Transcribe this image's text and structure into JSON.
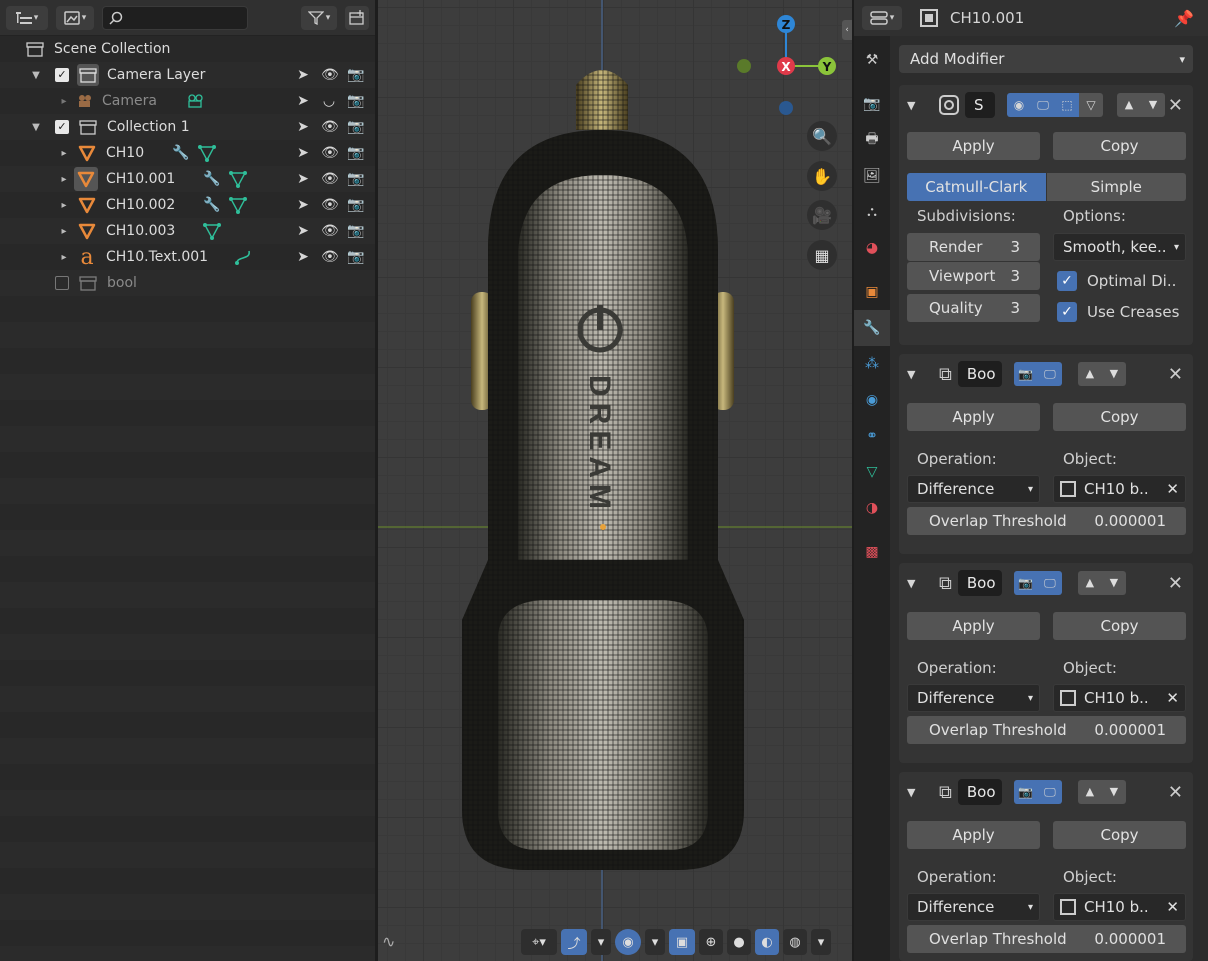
{
  "outliner": {
    "items": [
      {
        "label": "Scene Collection"
      },
      {
        "label": "Camera Layer"
      },
      {
        "label": "Camera"
      },
      {
        "label": "Collection 1"
      },
      {
        "label": "CH10"
      },
      {
        "label": "CH10.001"
      },
      {
        "label": "CH10.002"
      },
      {
        "label": "CH10.003"
      },
      {
        "label": "CH10.Text.001"
      },
      {
        "label": "bool"
      }
    ]
  },
  "viewport": {
    "axes": {
      "z": "Z",
      "x": "X",
      "y": "Y"
    },
    "model_text": "DREAM"
  },
  "properties": {
    "object_name": "CH10.001",
    "add_modifier": "Add Modifier",
    "subsurf": {
      "name": "S",
      "apply": "Apply",
      "copy": "Copy",
      "type_a": "Catmull-Clark",
      "type_b": "Simple",
      "subdivisions_label": "Subdivisions:",
      "options_label": "Options:",
      "render_label": "Render",
      "render_value": "3",
      "viewport_label": "Viewport",
      "viewport_value": "3",
      "quality_label": "Quality",
      "quality_value": "3",
      "uv_smooth": "Smooth, kee..",
      "optimal_display": "Optimal Di..",
      "use_creases": "Use Creases"
    },
    "booleans": [
      {
        "name": "Boo",
        "apply": "Apply",
        "copy": "Copy",
        "operation_label": "Operation:",
        "object_label": "Object:",
        "operation": "Difference",
        "object": "CH10 b..",
        "overlap_label": "Overlap Threshold",
        "overlap_value": "0.000001"
      },
      {
        "name": "Boo",
        "apply": "Apply",
        "copy": "Copy",
        "operation_label": "Operation:",
        "object_label": "Object:",
        "operation": "Difference",
        "object": "CH10 b..",
        "overlap_label": "Overlap Threshold",
        "overlap_value": "0.000001"
      },
      {
        "name": "Boo",
        "apply": "Apply",
        "copy": "Copy",
        "operation_label": "Operation:",
        "object_label": "Object:",
        "operation": "Difference",
        "object": "CH10 b..",
        "overlap_label": "Overlap Threshold",
        "overlap_value": "0.000001"
      }
    ]
  },
  "colors": {
    "accent": "#4772b3",
    "mesh_icon": "#e8893a",
    "modifier_icon": "#4a9bd6",
    "vertex_icon": "#2fbf9a"
  }
}
